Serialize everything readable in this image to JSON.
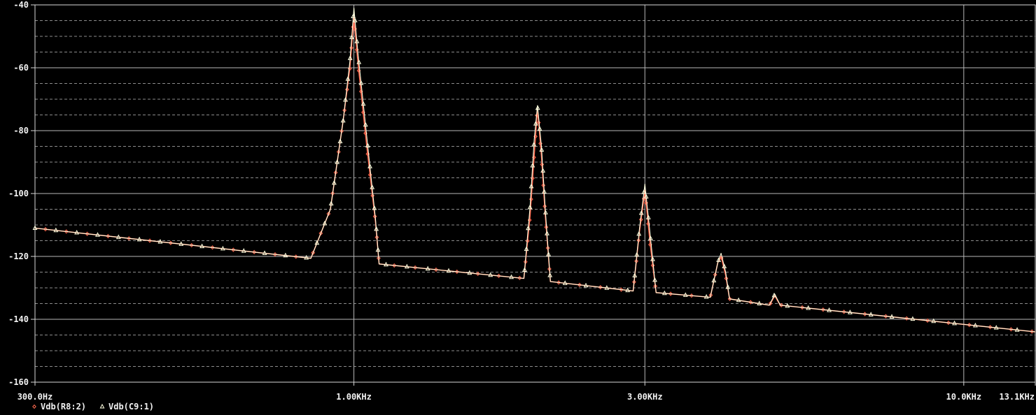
{
  "chart_data": {
    "type": "line",
    "x_scale": "log",
    "xlim": [
      300,
      13100
    ],
    "ylim": [
      -160,
      -40
    ],
    "grid": true,
    "x_ticks": [
      {
        "value": 300,
        "label": "300.0Hz"
      },
      {
        "value": 1000,
        "label": "1.00KHz"
      },
      {
        "value": 3000,
        "label": "3.00KHz"
      },
      {
        "value": 10000,
        "label": "10.0KHz"
      },
      {
        "value": 13100,
        "label": "13.1KHz"
      }
    ],
    "y_ticks": [
      {
        "value": -40,
        "label": "-40"
      },
      {
        "value": -60,
        "label": "-60"
      },
      {
        "value": -80,
        "label": "-80"
      },
      {
        "value": -100,
        "label": "-100"
      },
      {
        "value": -120,
        "label": "-120"
      },
      {
        "value": -140,
        "label": "-140"
      },
      {
        "value": -160,
        "label": "-160"
      }
    ],
    "legend_position": "bottom-left",
    "series": [
      {
        "name": "Vdb(R8:2)",
        "color": "#ff6a50",
        "marker": "diamond",
        "points": [
          [
            300,
            -111
          ],
          [
            850,
            -120.6
          ],
          [
            915,
            -105
          ],
          [
            960,
            -77
          ],
          [
            985,
            -60
          ],
          [
            1000,
            -44
          ],
          [
            1015,
            -58
          ],
          [
            1050,
            -85
          ],
          [
            1085,
            -109
          ],
          [
            1100,
            -122.4
          ],
          [
            1900,
            -127
          ],
          [
            1945,
            -107
          ],
          [
            1975,
            -88
          ],
          [
            2000,
            -73
          ],
          [
            2030,
            -88
          ],
          [
            2060,
            -107
          ],
          [
            2100,
            -128
          ],
          [
            2870,
            -131
          ],
          [
            2940,
            -112
          ],
          [
            3000,
            -99
          ],
          [
            3060,
            -116
          ],
          [
            3130,
            -131.5
          ],
          [
            3840,
            -133
          ],
          [
            3950,
            -122
          ],
          [
            4000,
            -120
          ],
          [
            4070,
            -126
          ],
          [
            4130,
            -133.5
          ],
          [
            4800,
            -135.5
          ],
          [
            4900,
            -132.5
          ],
          [
            5000,
            -135.5
          ],
          [
            13100,
            -144
          ]
        ]
      },
      {
        "name": "Vdb(C9:1)",
        "color": "#ffffe0",
        "marker": "triangle",
        "points": [
          [
            300,
            -111
          ],
          [
            850,
            -120.6
          ],
          [
            915,
            -105
          ],
          [
            960,
            -77
          ],
          [
            985,
            -58
          ],
          [
            1000,
            -41
          ],
          [
            1015,
            -55
          ],
          [
            1050,
            -82
          ],
          [
            1085,
            -108
          ],
          [
            1100,
            -122.4
          ],
          [
            1900,
            -127
          ],
          [
            1945,
            -104
          ],
          [
            1975,
            -83
          ],
          [
            2000,
            -72
          ],
          [
            2030,
            -85
          ],
          [
            2060,
            -105
          ],
          [
            2100,
            -128
          ],
          [
            2870,
            -131
          ],
          [
            2940,
            -111
          ],
          [
            3000,
            -97
          ],
          [
            3060,
            -113
          ],
          [
            3130,
            -131.5
          ],
          [
            3840,
            -133
          ],
          [
            3950,
            -122
          ],
          [
            4000,
            -119
          ],
          [
            4070,
            -125
          ],
          [
            4130,
            -133.5
          ],
          [
            4800,
            -135.5
          ],
          [
            4900,
            -132
          ],
          [
            5000,
            -135.5
          ],
          [
            13100,
            -144
          ]
        ]
      }
    ]
  }
}
